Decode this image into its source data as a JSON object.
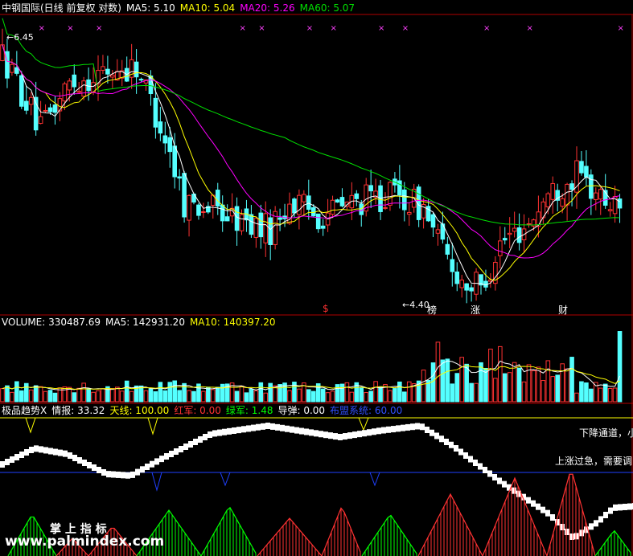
{
  "colors": {
    "up": "#ff3232",
    "down": "#54ffff",
    "ma5": "#ffffff",
    "ma10": "#ffff00",
    "ma20": "#ff00ff",
    "ma60": "#00e000",
    "frame": "#b00000",
    "grey": "#c0c0c0",
    "blue": "#4080ff",
    "green": "#00ff00",
    "red": "#ff3232"
  },
  "price_header": {
    "title": "中钢国际(日线 前复权 对数)",
    "ma5": "MA5: 5.10",
    "ma10": "MA10: 5.04",
    "ma20": "MA20: 5.26",
    "ma60": "MA60: 5.07"
  },
  "volume_header": {
    "title": "VOLUME: 330487.69",
    "ma5": "MA5: 142931.20",
    "ma10": "MA10: 140397.20"
  },
  "indicator_header": {
    "title": "极品趋势X",
    "qingbao": "情报: 33.32",
    "tianxian": "天线: 100.00",
    "hongjun": "红军: 0.00",
    "lvjun": "绿军: 1.48",
    "daodan": "导弹: 0.00",
    "baoman": "布盟系统: 60.00"
  },
  "annotations": {
    "high_label": "6.45",
    "low_label": "4.40",
    "marker_dollar": "$",
    "marker_bang": "榜",
    "marker_zhang": "涨",
    "marker_cai": "财",
    "note_down": "下降通道，小",
    "note_up": "上涨过急，需要调",
    "watermark_cn": "掌 上 指 标",
    "watermark_url": "www.palmindex.com"
  },
  "chart_data": {
    "type": "candlestick",
    "price_axis": {
      "scale": "log",
      "ylim": [
        4.3,
        6.6
      ]
    },
    "candles_count": 130,
    "volume_ylim": [
      0,
      340000
    ]
  }
}
